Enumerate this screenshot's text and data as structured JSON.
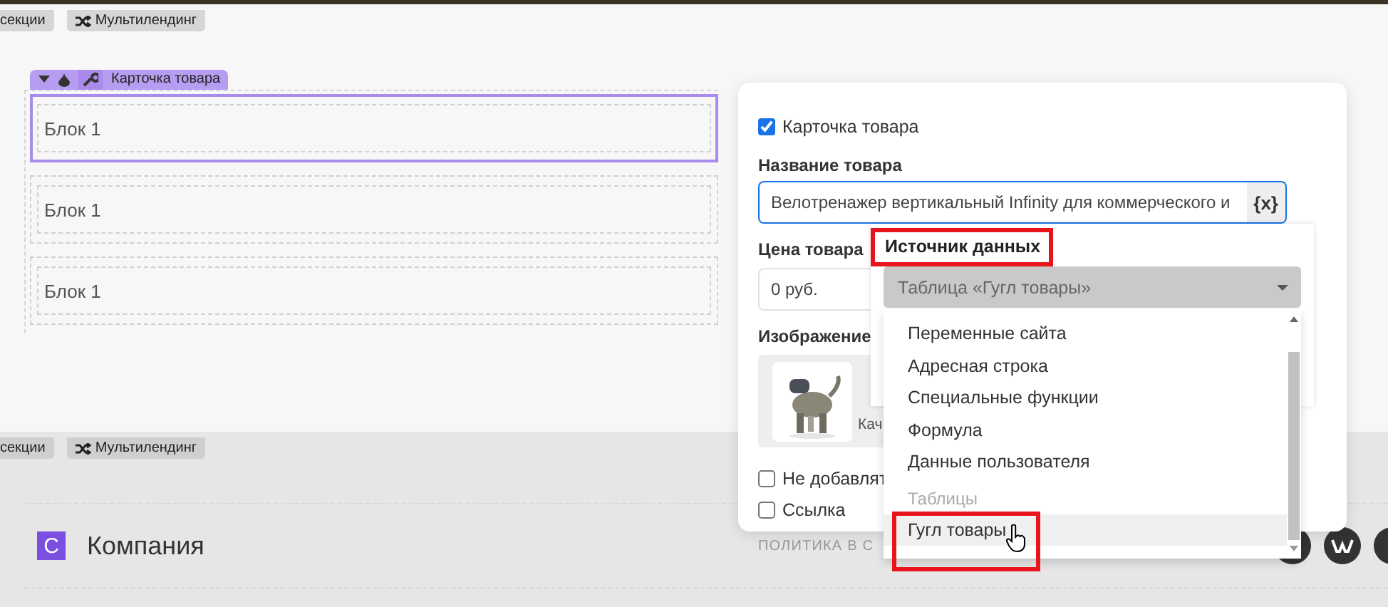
{
  "top_tags": [
    {
      "kind": "plain",
      "label": "секции"
    },
    {
      "kind": "shuffle",
      "label": "Мультилендинг"
    }
  ],
  "block": {
    "tab_label": "Карточка товара",
    "rows": [
      {
        "label": "Блок 1",
        "selected": true
      },
      {
        "label": "Блок 1",
        "selected": false
      },
      {
        "label": "Блок 1",
        "selected": false
      }
    ]
  },
  "bottom_tags": [
    {
      "kind": "plain",
      "label": "секции"
    },
    {
      "kind": "shuffle",
      "label": "Мультилендинг"
    }
  ],
  "footer": {
    "logo_letter": "С",
    "company": "Компания",
    "policy": "ПОЛИТИКА В С"
  },
  "panel": {
    "card_checkbox": {
      "label": "Карточка товара",
      "checked": true
    },
    "name_label": "Название товара",
    "name_value": "Велотренажер вертикальный Infinity для коммерческого и",
    "variable_button": "{x}",
    "price_label": "Цена товара",
    "price_value": "0 руб.",
    "image_label": "Изображение",
    "image_caption": "Кач",
    "options": [
      {
        "label": "Не добавлят",
        "checked": false
      },
      {
        "label": "Ссылка",
        "checked": false
      }
    ]
  },
  "dropdown": {
    "title": "Источник данных",
    "value": "Таблица «Гугл товары»",
    "items": [
      {
        "kind": "option",
        "label": "Переменные сайта",
        "hovered": false
      },
      {
        "kind": "option",
        "label": "Адресная строка",
        "hovered": false
      },
      {
        "kind": "option",
        "label": "Специальные функции",
        "hovered": false
      },
      {
        "kind": "option",
        "label": "Формула",
        "hovered": false
      },
      {
        "kind": "option",
        "label": "Данные пользователя",
        "hovered": false
      },
      {
        "kind": "group",
        "label": "Таблицы"
      },
      {
        "kind": "option",
        "label": "Гугл товары",
        "hovered": true
      }
    ]
  }
}
